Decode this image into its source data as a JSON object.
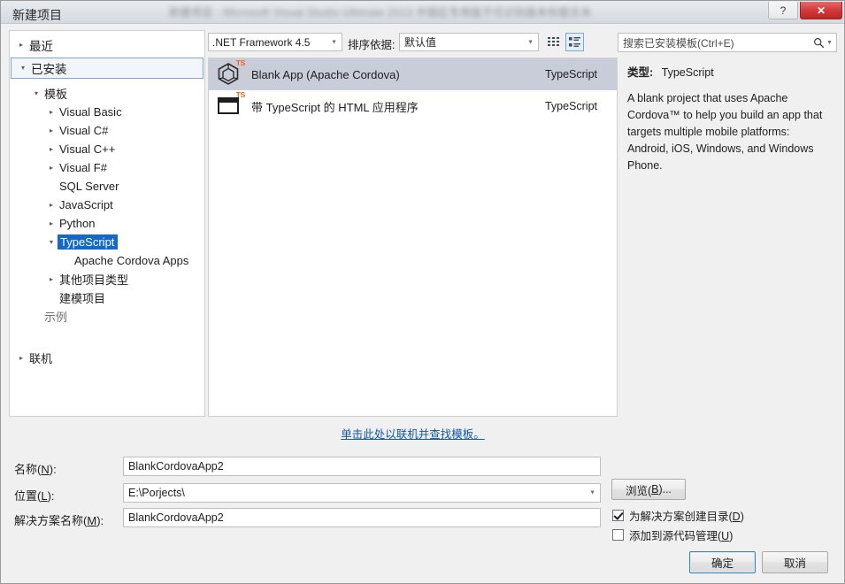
{
  "window": {
    "dialog_title": "新建项目",
    "titlebar_blurred_text": "新建项目 - Microsoft Visual Studio Ultimate 2013 中国区专用版不可识别版本标题文本",
    "help_button": "?",
    "close_button": "✕"
  },
  "tree": {
    "items": [
      {
        "label": "最近",
        "indent": 0,
        "arrow": "collapsed",
        "state": "normal"
      },
      {
        "label": "已安装",
        "indent": 0,
        "arrow": "expanded",
        "state": "selected-box"
      },
      {
        "label": "模板",
        "indent": 1,
        "arrow": "expanded",
        "state": "normal"
      },
      {
        "label": "Visual Basic",
        "indent": 2,
        "arrow": "collapsed",
        "state": "normal"
      },
      {
        "label": "Visual C#",
        "indent": 2,
        "arrow": "collapsed",
        "state": "normal"
      },
      {
        "label": "Visual C++",
        "indent": 2,
        "arrow": "collapsed",
        "state": "normal"
      },
      {
        "label": "Visual F#",
        "indent": 2,
        "arrow": "collapsed",
        "state": "normal"
      },
      {
        "label": "SQL Server",
        "indent": 2,
        "arrow": "none",
        "state": "normal"
      },
      {
        "label": "JavaScript",
        "indent": 2,
        "arrow": "collapsed",
        "state": "normal"
      },
      {
        "label": "Python",
        "indent": 2,
        "arrow": "collapsed",
        "state": "normal"
      },
      {
        "label": "TypeScript",
        "indent": 2,
        "arrow": "expanded",
        "state": "selected-blue"
      },
      {
        "label": "Apache Cordova Apps",
        "indent": 3,
        "arrow": "none",
        "state": "normal"
      },
      {
        "label": "其他项目类型",
        "indent": 2,
        "arrow": "collapsed",
        "state": "normal"
      },
      {
        "label": "建模项目",
        "indent": 2,
        "arrow": "none",
        "state": "normal"
      },
      {
        "label": "示例",
        "indent": 1,
        "arrow": "none",
        "state": "dim"
      },
      {
        "label": "联机",
        "indent": 0,
        "arrow": "collapsed",
        "state": "normal"
      }
    ]
  },
  "toolbar": {
    "framework": ".NET Framework 4.5",
    "sort_label": "排序依据:",
    "sort_value": "默认值",
    "grid_view_icon": "small-icons-view-icon",
    "list_view_icon": "large-list-view-icon",
    "list_view_selected": true
  },
  "search": {
    "placeholder": "搜索已安装模板(Ctrl+E)",
    "value": "",
    "icon": "search-icon",
    "dropdown_icon": "chevron-down-icon"
  },
  "templates": {
    "items": [
      {
        "name": "Blank App (Apache Cordova)",
        "language": "TypeScript",
        "icon": "cordova-cube-icon",
        "badge": "TS",
        "selected": true
      },
      {
        "name": "带 TypeScript 的 HTML 应用程序",
        "language": "TypeScript",
        "icon": "html-app-window-icon",
        "badge": "TS",
        "selected": false
      }
    ],
    "online_link": "单击此处以联机并查找模板。"
  },
  "description": {
    "type_label": "类型:",
    "type_value": "TypeScript",
    "body": "A blank project that uses Apache Cordova™ to help you build an app that targets multiple mobile platforms: Android, iOS, Windows, and Windows Phone."
  },
  "form": {
    "name_label": "名称(N):",
    "name_value": "BlankCordovaApp2",
    "location_label": "位置(L):",
    "location_value": "E:\\Porjects\\",
    "solution_label": "解决方案名称(M):",
    "solution_value": "BlankCordovaApp2",
    "browse_button": "浏览(B)...",
    "create_dir_checkbox": "为解决方案创建目录(D)",
    "create_dir_checked": true,
    "source_control_checkbox": "添加到源代码管理(U)",
    "source_control_checked": false
  },
  "footer": {
    "ok_button": "确定",
    "cancel_button": "取消"
  },
  "colors": {
    "accent_blue": "#1469c8",
    "link_blue": "#1057a8",
    "ts_orange": "#e8681c",
    "selection_gray": "#c9ccd9",
    "close_red": "#d33a3a"
  }
}
